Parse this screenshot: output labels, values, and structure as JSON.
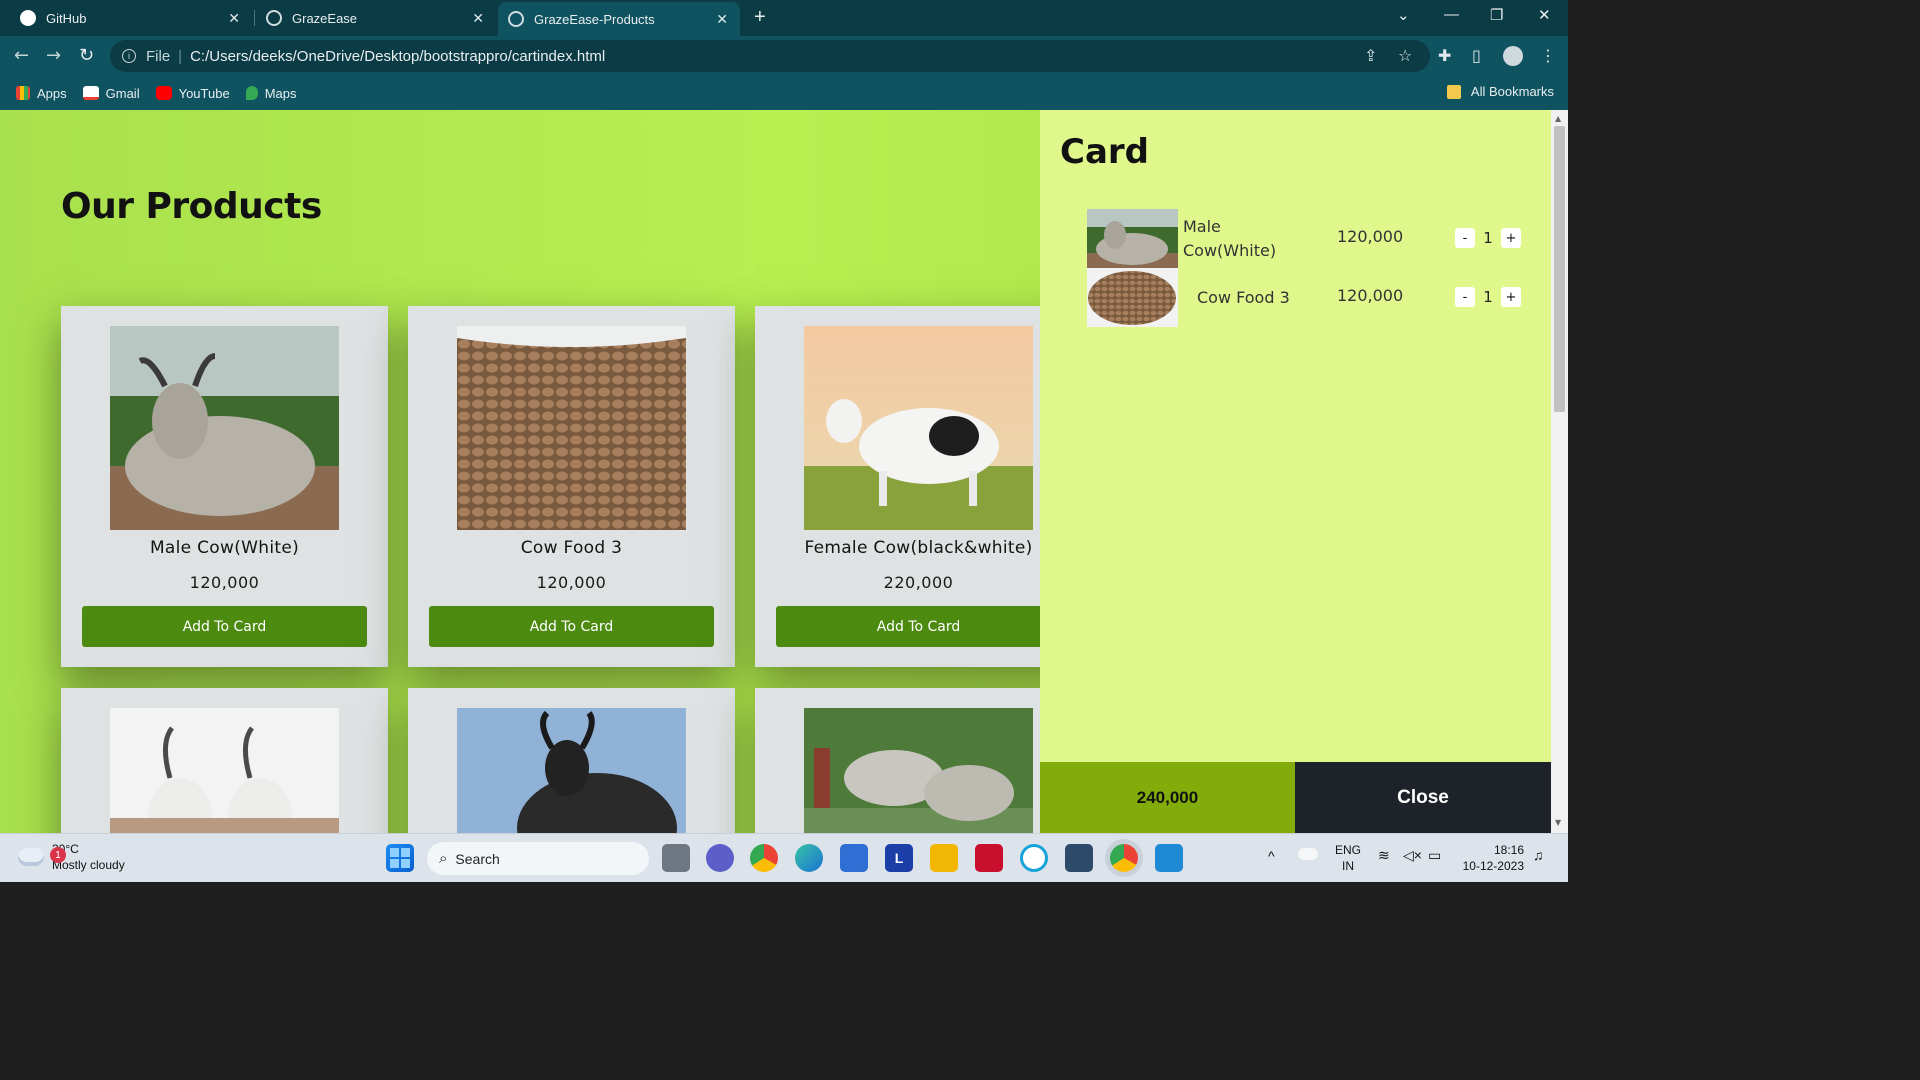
{
  "browser": {
    "tabs": [
      {
        "title": "GitHub"
      },
      {
        "title": "GrazeEase"
      },
      {
        "title": "GrazeEase-Products"
      }
    ],
    "address": {
      "scheme": "File",
      "url": "C:/Users/deeks/OneDrive/Desktop/bootstrappro/cartindex.html"
    },
    "bookmarks": [
      {
        "label": "Apps"
      },
      {
        "label": "Gmail"
      },
      {
        "label": "YouTube"
      },
      {
        "label": "Maps"
      }
    ],
    "all_bookmarks": "All Bookmarks"
  },
  "page": {
    "title": "Our Products",
    "products": [
      {
        "name": "Male Cow(White)",
        "price": "120,000",
        "button": "Add To Card"
      },
      {
        "name": "Cow Food 3",
        "price": "120,000",
        "button": "Add To Card"
      },
      {
        "name": "Female Cow(black&white)",
        "price": "220,000",
        "button": "Add To Card"
      }
    ]
  },
  "cart": {
    "title": "Card",
    "items": [
      {
        "name": "Male Cow(White)",
        "price": "120,000",
        "qty": "1",
        "minus": "-",
        "plus": "+"
      },
      {
        "name": "Cow Food 3",
        "price": "120,000",
        "qty": "1",
        "minus": "-",
        "plus": "+"
      }
    ],
    "total": "240,000",
    "close_label": "Close"
  },
  "taskbar": {
    "weather_temp": "30°C",
    "weather_desc": "Mostly cloudy",
    "notification_count": "1",
    "search_label": "Search",
    "lang_top": "ENG",
    "lang_bottom": "IN",
    "time": "18:16",
    "date": "10-12-2023"
  }
}
